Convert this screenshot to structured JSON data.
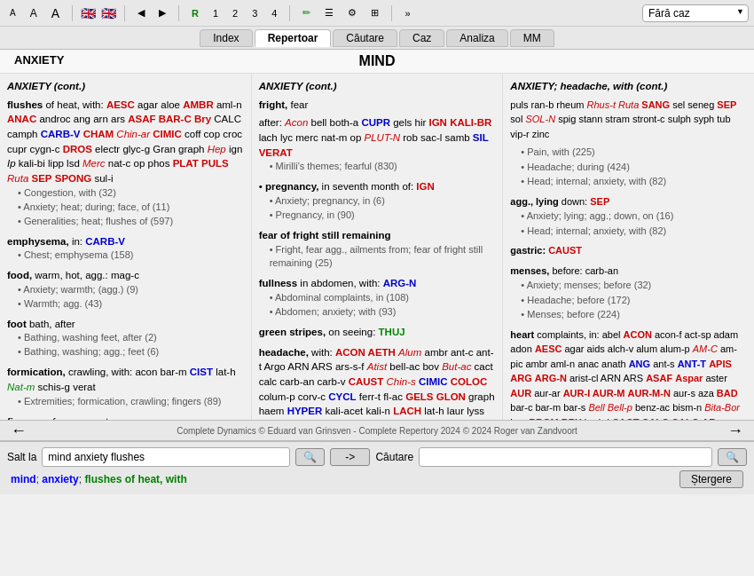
{
  "toolbar": {
    "font_small": "A",
    "font_med": "A",
    "font_large": "A",
    "flag1": "🇬🇧",
    "flag2": "🇬🇧",
    "btn_prev": "◀",
    "btn_next": "▶",
    "btn_r": "R",
    "btn_1": "1",
    "btn_2": "2",
    "btn_3": "3",
    "btn_4": "4",
    "btn_pen": "✏",
    "btn_list": "☰",
    "btn_tool": "⚙",
    "btn_qr": "⊞",
    "btn_expand": "»",
    "dropdown_value": "Fără caz"
  },
  "nav_tabs": [
    "Index",
    "Repertoar",
    "Căutare",
    "Caz",
    "Analiza",
    "MM"
  ],
  "active_tab": "Repertoar",
  "section": {
    "left": "ANXIETY",
    "center": "MIND",
    "right": ""
  },
  "columns": [
    {
      "id": "col1",
      "header": "ANXIETY (cont.)",
      "content": "col1"
    },
    {
      "id": "col2",
      "header": "ANXIETY (cont.)",
      "content": "col2"
    },
    {
      "id": "col3",
      "header": "ANXIETY; headache, with (cont.)",
      "content": "col3"
    }
  ],
  "nav_bottom": {
    "copyright": "Complete Dynamics © Eduard van Grinsven   -   Complete Repertory 2024 © 2024 Roger van Zandvoort"
  },
  "search": {
    "label": "Salt la",
    "input_value": "mind anxiety flushes",
    "search_btn": "🔍",
    "arrow_btn": "->",
    "right_label": "Căutare",
    "right_input": "",
    "right_search_btn": "🔍",
    "delete_btn": "Ștergere"
  },
  "result_text": "mind; anxiety; flushes of heat, with"
}
